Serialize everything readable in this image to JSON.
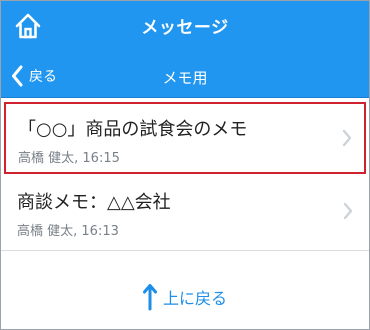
{
  "header": {
    "title": "メッセージ",
    "back_label": "戻る",
    "folder_title": "メモ用"
  },
  "messages": [
    {
      "title": "「○○」商品の試食会のメモ",
      "author": "高橋 健太",
      "time": "16:15",
      "meta": "高橋 健太, 16:15",
      "selected": true
    },
    {
      "title": "商談メモ：△△会社",
      "author": "高橋 健太",
      "time": "16:13",
      "meta": "高橋 健太, 16:13",
      "selected": false
    }
  ],
  "footer": {
    "up_label": "上に戻る"
  },
  "colors": {
    "header_bg": "#2196f0",
    "selection_border": "#d0212f",
    "link": "#1e8ee6"
  },
  "icons": {
    "home": "home-icon",
    "back": "chevron-left-icon",
    "row": "chevron-right-icon",
    "up": "arrow-up-icon"
  }
}
